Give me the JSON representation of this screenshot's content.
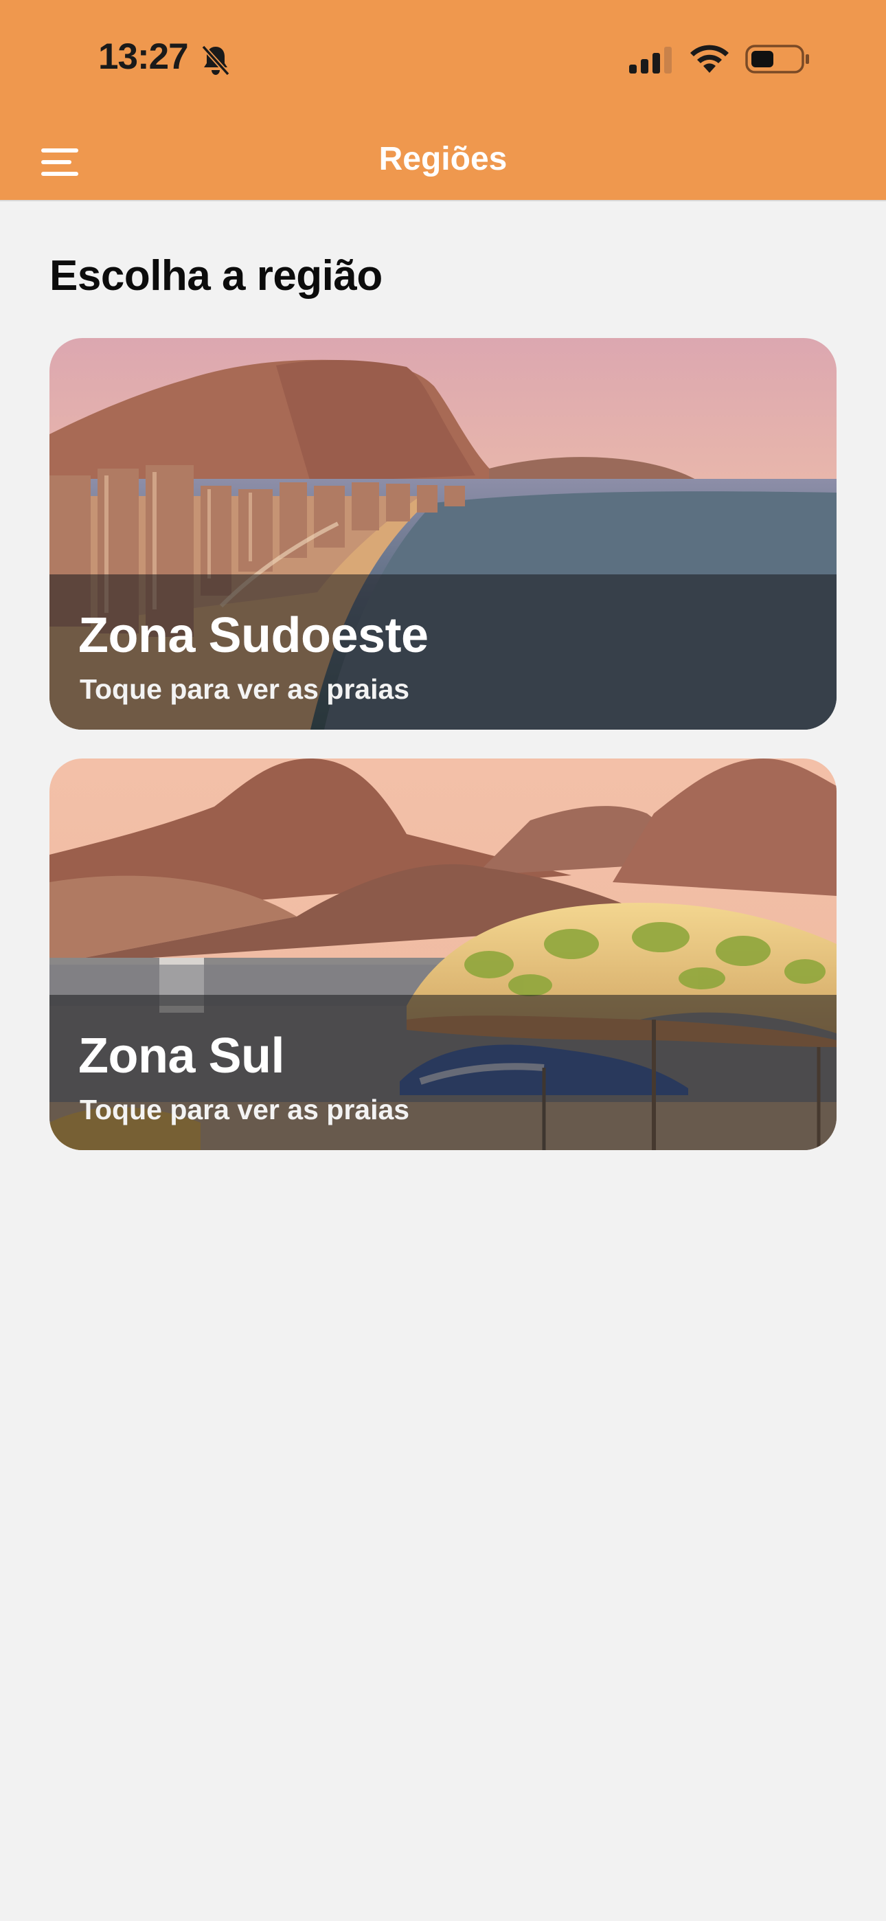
{
  "status_bar": {
    "time": "13:27",
    "icons": [
      "bell-slash-icon",
      "cellular-signal-icon",
      "wifi-icon",
      "battery-icon"
    ]
  },
  "header": {
    "title": "Regiões",
    "menu_icon": "hamburger-menu-icon",
    "background_color": "#ef984e"
  },
  "main": {
    "section_title": "Escolha a região",
    "regions": [
      {
        "name": "Zona Sudoeste",
        "subtitle": "Toque para ver as praias"
      },
      {
        "name": "Zona Sul",
        "subtitle": "Toque para ver as praias"
      }
    ]
  },
  "colors": {
    "page_background": "#f2f2f2",
    "header_text": "#ffffff",
    "card_overlay": "rgba(25, 25, 30, 0.55)"
  }
}
